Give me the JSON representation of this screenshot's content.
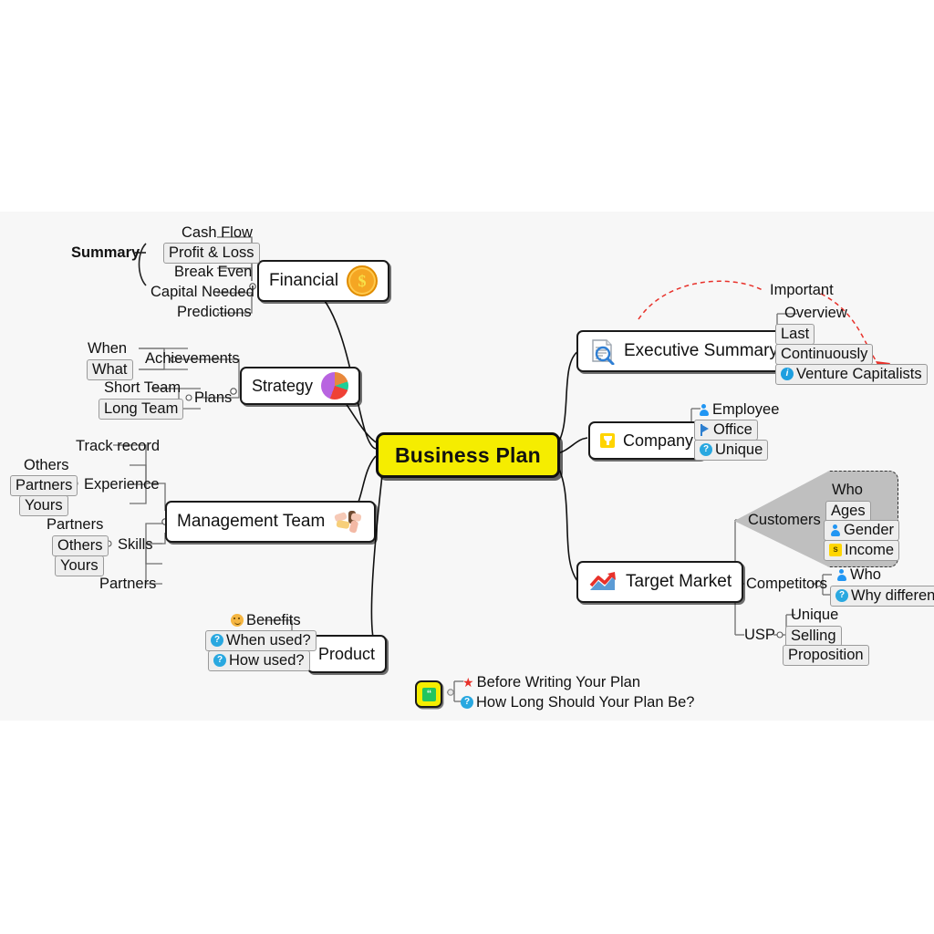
{
  "canvas": {
    "background": "#f7f7f7",
    "accent_yellow": "#f5ed00",
    "accent_red": "#e8312a"
  },
  "central": {
    "label": "Business Plan"
  },
  "branches": {
    "financial": {
      "label": "Financial",
      "icon": "coin-dollar-icon",
      "group_label": "Summary",
      "children": [
        {
          "label": "Cash Flow"
        },
        {
          "label": "Profit & Loss"
        },
        {
          "label": "Break Even"
        },
        {
          "label": "Capital Needed"
        },
        {
          "label": "Predictions"
        }
      ]
    },
    "strategy": {
      "label": "Strategy",
      "icon": "pie-chart-icon",
      "children": [
        {
          "label": "Achievements",
          "children": [
            {
              "label": "When"
            },
            {
              "label": "What"
            }
          ]
        },
        {
          "label": "Plans",
          "children": [
            {
              "label": "Short Team"
            },
            {
              "label": "Long Team"
            }
          ]
        }
      ]
    },
    "management_team": {
      "label": "Management Team",
      "icon": "handshake-icon",
      "children": [
        {
          "label": "Experience",
          "children": [
            {
              "label": "Track record"
            },
            {
              "label": "Others"
            },
            {
              "label": "Partners"
            },
            {
              "label": "Yours"
            }
          ]
        },
        {
          "label": "Skills",
          "children": [
            {
              "label": "Partners"
            },
            {
              "label": "Others"
            },
            {
              "label": "Yours"
            },
            {
              "label": "Partners"
            }
          ]
        }
      ]
    },
    "product": {
      "label": "Product",
      "children": [
        {
          "label": "Benefits",
          "icon": "smiley-icon"
        },
        {
          "label": "When used?",
          "icon": "question-icon"
        },
        {
          "label": "How used?",
          "icon": "question-icon"
        }
      ]
    },
    "executive_summary": {
      "label": "Executive Summary",
      "icon": "document-search-icon",
      "callout": "Important",
      "children": [
        {
          "label": "Overview"
        },
        {
          "label": "Last"
        },
        {
          "label": "Continuously"
        },
        {
          "label": "Venture Capitalists",
          "icon": "info-icon"
        }
      ]
    },
    "company": {
      "label": "Company",
      "icon": "trophy-icon",
      "children": [
        {
          "label": "Employee",
          "icon": "person-icon"
        },
        {
          "label": "Office",
          "icon": "flag-icon"
        },
        {
          "label": "Unique",
          "icon": "question-icon"
        }
      ]
    },
    "target_market": {
      "label": "Target Market",
      "icon": "growth-chart-icon",
      "children": [
        {
          "label": "Customers",
          "highlight": true,
          "children": [
            {
              "label": "Who"
            },
            {
              "label": "Ages"
            },
            {
              "label": "Gender",
              "icon": "person-icon"
            },
            {
              "label": "Income",
              "icon": "money-icon"
            }
          ]
        },
        {
          "label": "Competitors",
          "children": [
            {
              "label": "Who",
              "icon": "person-icon"
            },
            {
              "label": "Why different",
              "icon": "question-icon"
            }
          ]
        },
        {
          "label": "USP",
          "children": [
            {
              "label": "Unique"
            },
            {
              "label": "Selling"
            },
            {
              "label": "Proposition"
            }
          ]
        }
      ]
    },
    "notes": {
      "icon": "quote-note-icon",
      "children": [
        {
          "label": "Before Writing Your Plan",
          "icon": "star-icon"
        },
        {
          "label": "How Long Should Your Plan Be?",
          "icon": "question-icon"
        }
      ]
    }
  }
}
